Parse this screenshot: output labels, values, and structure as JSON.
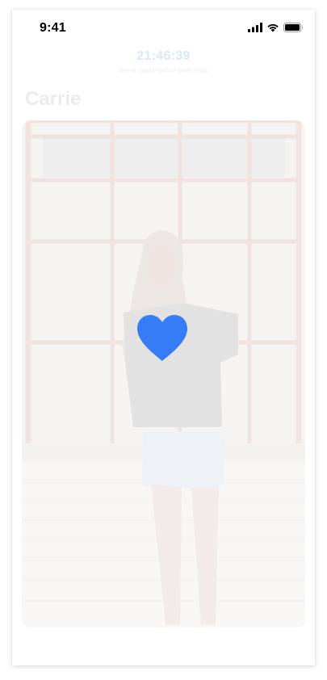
{
  "status_bar": {
    "time": "9:41",
    "icons": [
      "cellular-signal-icon",
      "wifi-icon",
      "battery-icon"
    ]
  },
  "timer": {
    "value": "21:46:39",
    "hint": "like or dislike before timer ends"
  },
  "profile": {
    "name": "Carrie",
    "photo_icon": "profile-photo"
  },
  "overlay": {
    "icon": "heart-icon",
    "color": "#357cf6"
  },
  "colors": {
    "accent": "#357cf6",
    "timer_text": "#dbe6f6",
    "faded_text": "#ececec"
  }
}
